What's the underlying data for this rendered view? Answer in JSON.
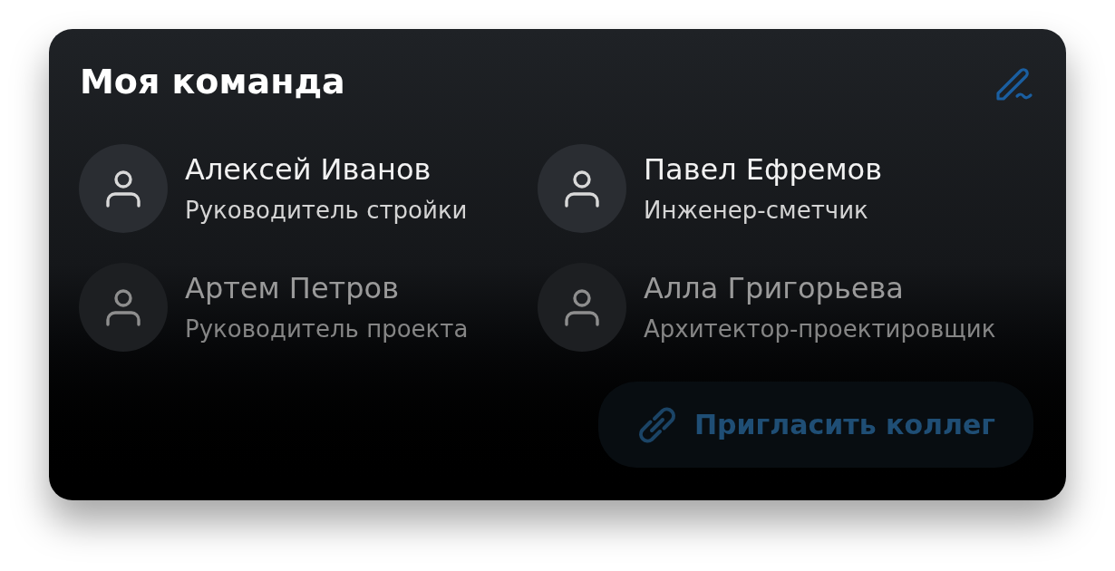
{
  "card": {
    "title": "Моя команда",
    "members": [
      {
        "name": "Алексей Иванов",
        "role": "Руководитель стройки",
        "faded": false
      },
      {
        "name": "Павел Ефремов",
        "role": "Инженер-сметчик",
        "faded": false
      },
      {
        "name": "Артем Петров",
        "role": "Руководитель проекта",
        "faded": true
      },
      {
        "name": "Алла Григорьева",
        "role": "Архитектор-проектировщик",
        "faded": true
      }
    ],
    "invite_button": {
      "label": "Пригласить коллег",
      "disabled": true
    }
  }
}
